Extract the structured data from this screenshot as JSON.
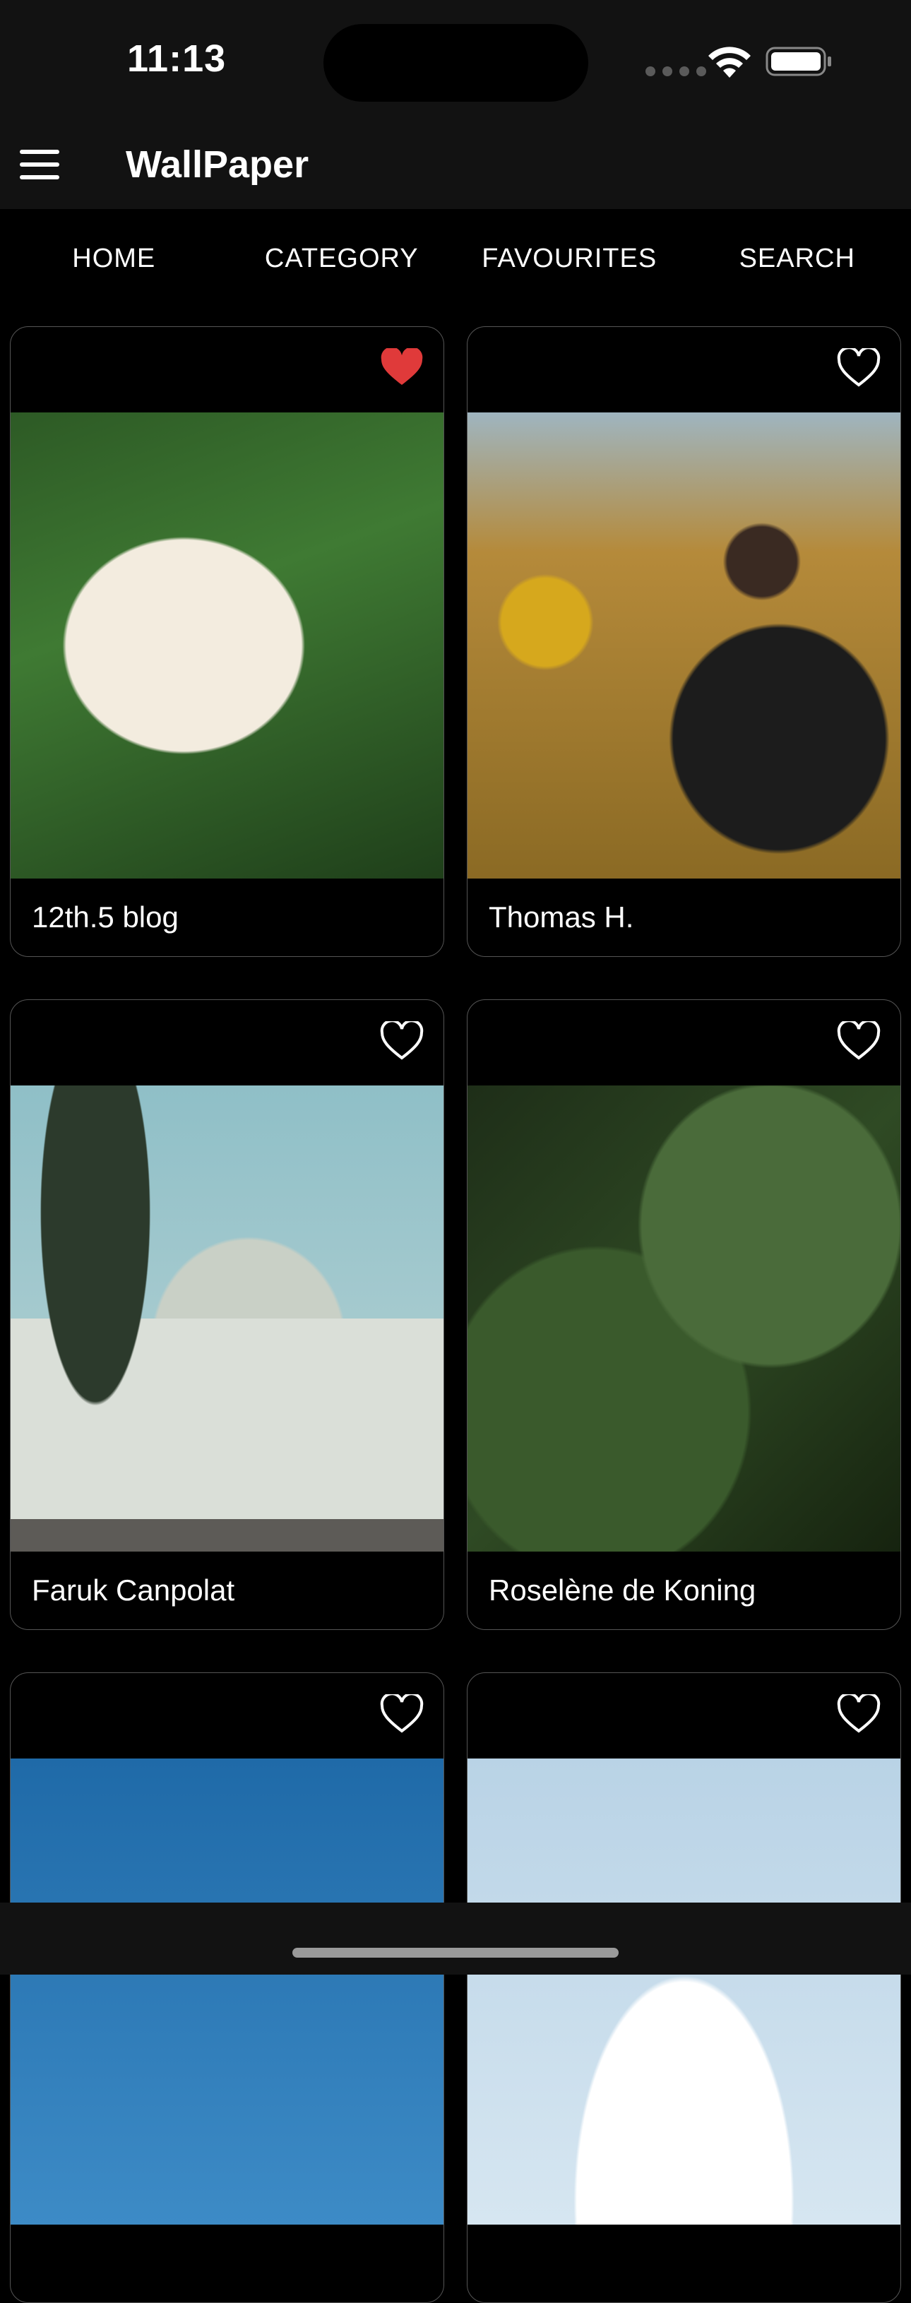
{
  "status_bar": {
    "time": "11:13"
  },
  "app_bar": {
    "title": "WallPaper",
    "menu_icon": "hamburger-menu-icon"
  },
  "tabs": [
    {
      "label": "HOME"
    },
    {
      "label": "CATEGORY"
    },
    {
      "label": "FAVOURITES"
    },
    {
      "label": "SEARCH"
    }
  ],
  "cards": [
    {
      "caption": "12th.5 blog",
      "favourited": true
    },
    {
      "caption": "Thomas H.",
      "favourited": false
    },
    {
      "caption": "Faruk Canpolat",
      "favourited": false
    },
    {
      "caption": "Roselène de Koning",
      "favourited": false
    },
    {
      "caption": "",
      "favourited": false
    },
    {
      "caption": "",
      "favourited": false
    }
  ],
  "colors": {
    "background": "#000000",
    "bar": "#121212",
    "favourite_active": "#e03a3a",
    "text": "#ffffff"
  }
}
